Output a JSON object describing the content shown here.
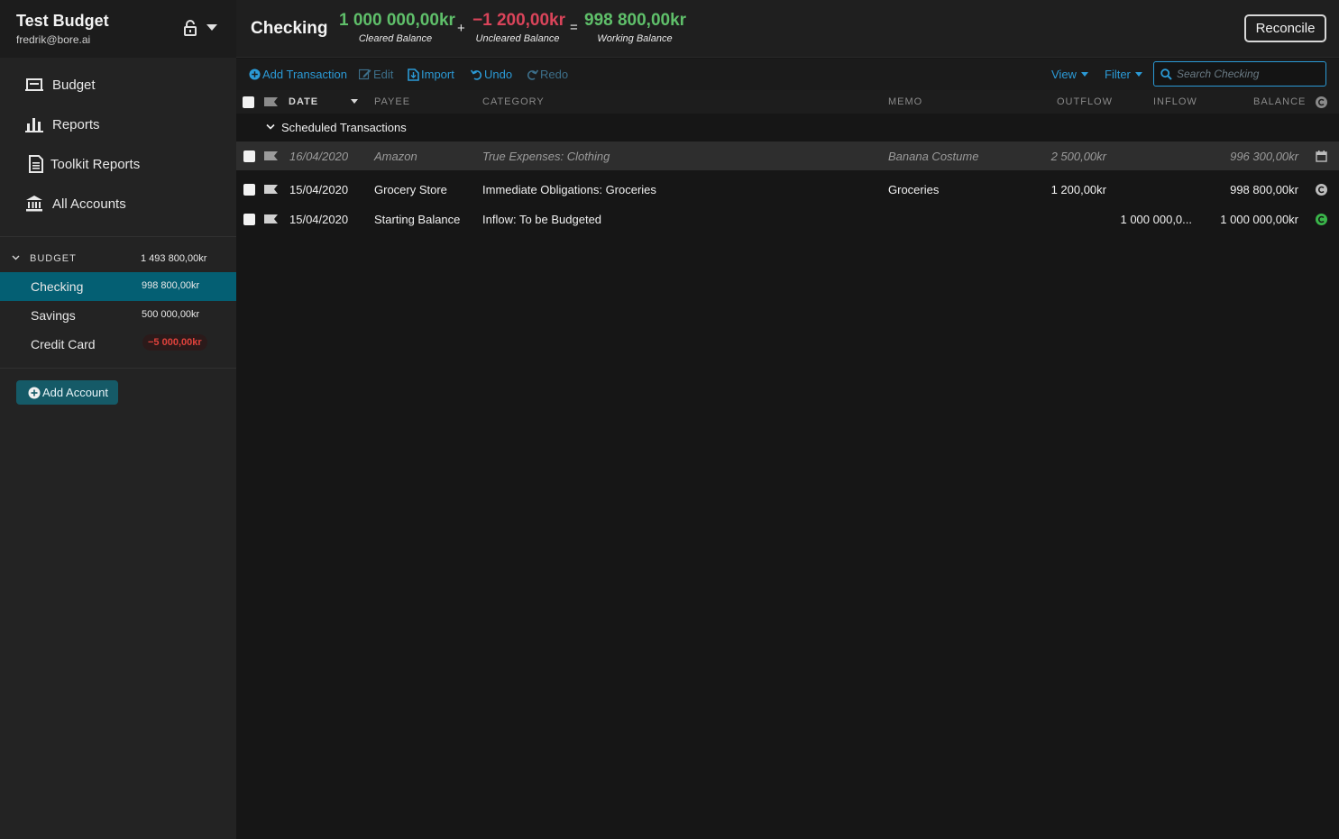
{
  "sidebar": {
    "budget_name": "Test Budget",
    "user_email": "fredrik@bore.ai",
    "nav": [
      {
        "label": "Budget",
        "icon": "budget-icon"
      },
      {
        "label": "Reports",
        "icon": "bar-chart-icon"
      },
      {
        "label": "Toolkit Reports",
        "icon": "document-icon"
      },
      {
        "label": "All Accounts",
        "icon": "bank-icon"
      }
    ],
    "group": {
      "label": "BUDGET",
      "total": "1 493 800,00kr"
    },
    "accounts": [
      {
        "name": "Checking",
        "balance": "998 800,00kr",
        "active": true
      },
      {
        "name": "Savings",
        "balance": "500 000,00kr"
      },
      {
        "name": "Credit Card",
        "balance": "−5 000,00kr",
        "negative": true
      }
    ],
    "add_account_label": "Add Account"
  },
  "header": {
    "account_title": "Checking",
    "cleared": {
      "amount": "1 000 000,00kr",
      "caption": "Cleared Balance"
    },
    "uncleared": {
      "amount": "−1 200,00kr",
      "caption": "Uncleared Balance"
    },
    "working": {
      "amount": "998 800,00kr",
      "caption": "Working Balance"
    },
    "plus": "+",
    "equals": "=",
    "reconcile_label": "Reconcile"
  },
  "toolbar": {
    "add_transaction": "Add Transaction",
    "edit": "Edit",
    "import": "Import",
    "undo": "Undo",
    "redo": "Redo",
    "view": "View",
    "filter": "Filter",
    "search_placeholder": "Search Checking"
  },
  "columns": {
    "date": "DATE",
    "payee": "PAYEE",
    "category": "CATEGORY",
    "memo": "MEMO",
    "outflow": "OUTFLOW",
    "inflow": "INFLOW",
    "balance": "BALANCE"
  },
  "scheduled_label": "Scheduled Transactions",
  "transactions": [
    {
      "date": "16/04/2020",
      "payee": "Amazon",
      "category": "True Expenses: Clothing",
      "memo": "Banana Costume",
      "outflow": "2 500,00kr",
      "inflow": "",
      "balance": "996 300,00kr",
      "status": "scheduled"
    },
    {
      "date": "15/04/2020",
      "payee": "Grocery Store",
      "category": "Immediate Obligations: Groceries",
      "memo": "Groceries",
      "outflow": "1 200,00kr",
      "inflow": "",
      "balance": "998 800,00kr",
      "status": "uncleared"
    },
    {
      "date": "15/04/2020",
      "payee": "Starting Balance",
      "category": "Inflow: To be Budgeted",
      "memo": "",
      "outflow": "",
      "inflow": "1 000 000,0...",
      "balance": "1 000 000,00kr",
      "status": "cleared"
    }
  ],
  "colors": {
    "accent": "#2b9ad6",
    "active_account": "#045f73",
    "positive": "#5fbf6a",
    "negative": "#d9445a",
    "cleared": "#3ab54a"
  }
}
